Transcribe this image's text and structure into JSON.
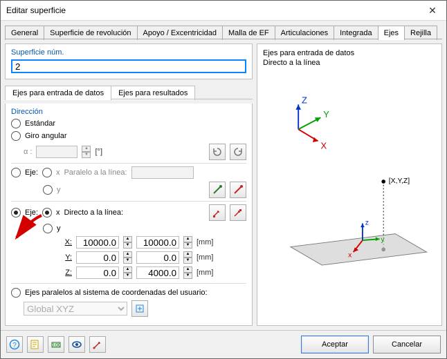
{
  "window": {
    "title": "Editar superficie"
  },
  "tabs": [
    "General",
    "Superficie de revolución",
    "Apoyo / Excentricidad",
    "Malla de EF",
    "Articulaciones",
    "Integrada",
    "Ejes",
    "Rejilla"
  ],
  "active_tab_index": 6,
  "surface_num": {
    "title": "Superficie núm.",
    "value": "2"
  },
  "subtabs": {
    "input": "Ejes para entrada de datos",
    "results": "Ejes para resultados",
    "active": 0
  },
  "direction": {
    "title": "Dirección",
    "standard": "Estándar",
    "angular": "Giro angular",
    "alpha_label": "α :",
    "alpha_unit": "[°]",
    "axis_parallel": {
      "axis": "Eje:",
      "x": "x",
      "y": "y",
      "label": "Paralelo a la línea:",
      "value": ""
    },
    "axis_direct": {
      "axis": "Eje:",
      "x": "x",
      "y": "y",
      "label": "Directo a la línea:",
      "X_label": "X:",
      "Y_label": "Y:",
      "Z_label": "Z:",
      "x1": "10000.0",
      "x2": "10000.0",
      "y1": "0.0",
      "y2": "0.0",
      "z1": "0.0",
      "z2": "4000.0",
      "unit": "[mm]"
    },
    "ucs_label": "Ejes paralelos al sistema de coordenadas del usuario:",
    "ucs_value": "Global XYZ"
  },
  "preview": {
    "line1": "Ejes para entrada de datos",
    "line2": "Directo a la línea",
    "XYZ_label": "[X,Y,Z]",
    "ax_x": "X",
    "ax_y": "Y",
    "ax_z": "Z",
    "lx": "x",
    "ly": "y",
    "lz": "z"
  },
  "footer": {
    "ok": "Aceptar",
    "cancel": "Cancelar"
  }
}
